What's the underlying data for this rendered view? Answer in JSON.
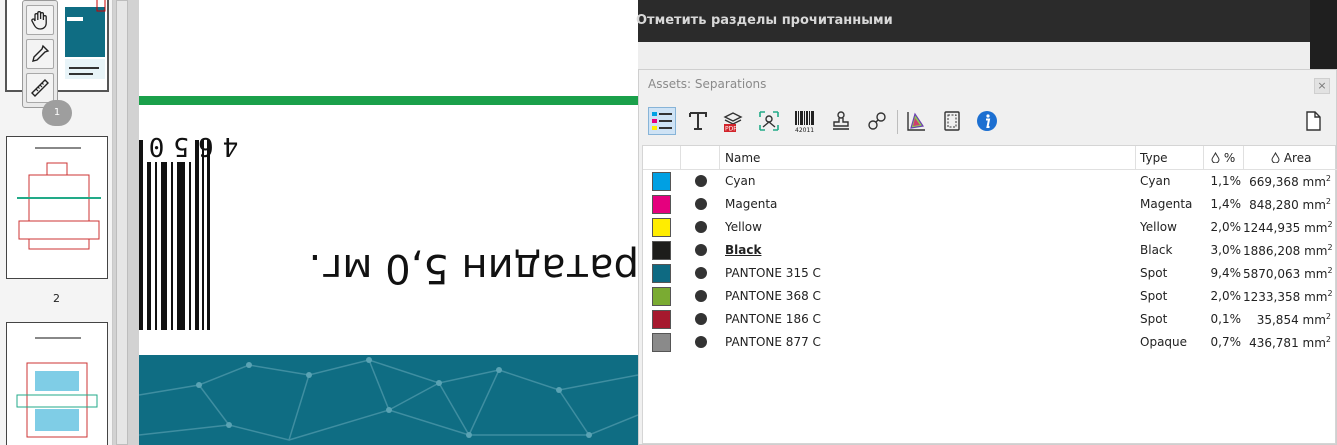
{
  "header": {
    "mark_sections_read": "Отметить разделы прочитанными"
  },
  "thumbnails": {
    "page_number": "2",
    "badge": "1"
  },
  "document": {
    "barcode_digits": "4650",
    "rotated_text": "ратадин 5,0 мг."
  },
  "panel": {
    "title": "Assets: Separations",
    "close_label": "×",
    "toolbar": [
      {
        "name": "list-view-icon",
        "active": true
      },
      {
        "name": "text-icon",
        "active": false
      },
      {
        "name": "pdf-layers-icon",
        "active": false
      },
      {
        "name": "image-icon",
        "active": false
      },
      {
        "name": "barcode-icon",
        "active": false
      },
      {
        "name": "stamp-icon",
        "active": false
      },
      {
        "name": "link-icon",
        "active": false
      },
      {
        "name": "color-gamut-icon",
        "active": false
      },
      {
        "name": "page-box-icon",
        "active": false
      },
      {
        "name": "info-icon",
        "active": false
      },
      {
        "name": "new-document-icon",
        "active": false
      }
    ],
    "columns": {
      "name": "Name",
      "type": "Type",
      "pct": "%",
      "area": "Area"
    },
    "rows": [
      {
        "color": "#00a0e3",
        "name": "Cyan",
        "type": "Cyan",
        "pct": "1,1%",
        "area": "669,368 mm",
        "bold": false
      },
      {
        "color": "#e5007e",
        "name": "Magenta",
        "type": "Magenta",
        "pct": "1,4%",
        "area": "848,280 mm",
        "bold": false
      },
      {
        "color": "#ffed00",
        "name": "Yellow",
        "type": "Yellow",
        "pct": "2,0%",
        "area": "1244,935 mm",
        "bold": false
      },
      {
        "color": "#1d1d1b",
        "name": "Black",
        "type": "Black",
        "pct": "3,0%",
        "area": "1886,208 mm",
        "bold": true
      },
      {
        "color": "#0e6a82",
        "name": "PANTONE 315 C",
        "type": "Spot",
        "pct": "9,4%",
        "area": "5870,063 mm",
        "bold": false
      },
      {
        "color": "#7aab32",
        "name": "PANTONE 368 C",
        "type": "Spot",
        "pct": "2,0%",
        "area": "1233,358 mm",
        "bold": false
      },
      {
        "color": "#a6192e",
        "name": "PANTONE 186 C",
        "type": "Spot",
        "pct": "0,1%",
        "area": "35,854 mm",
        "bold": false
      },
      {
        "color": "#8a8a8a",
        "name": "PANTONE 877 C",
        "type": "Opaque",
        "pct": "0,7%",
        "area": "436,781 mm",
        "bold": false
      }
    ],
    "area_unit_superscript": "2"
  }
}
